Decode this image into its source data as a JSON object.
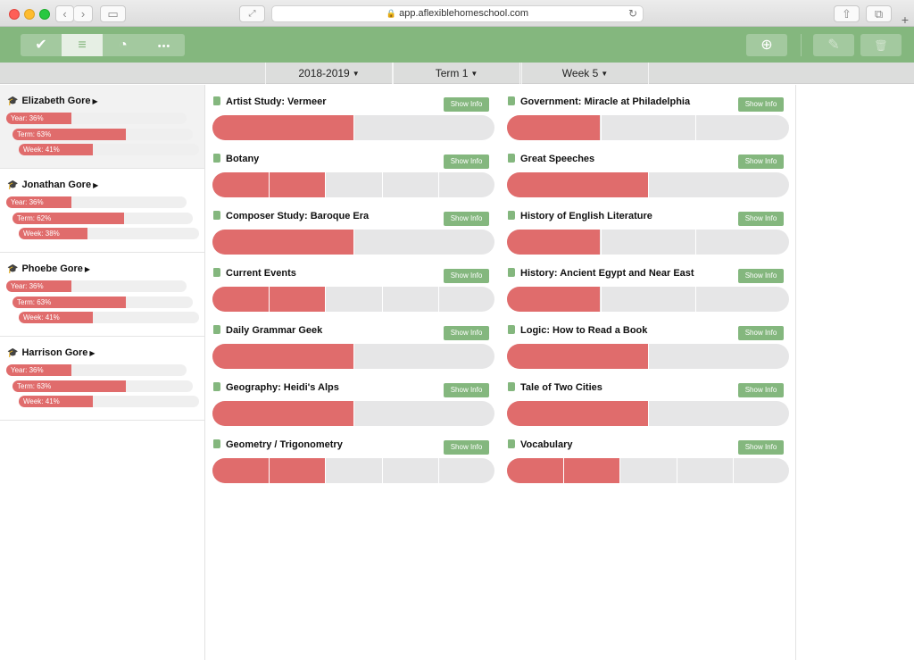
{
  "browser": {
    "url": "app.aflexiblehomeschool.com",
    "back_glyph": "‹",
    "fwd_glyph": "›",
    "sidebar_glyph": "▭",
    "reader_glyph": "⤢",
    "reload_glyph": "↻",
    "lock_glyph": "🔒",
    "share_glyph": "⇧",
    "tabs_glyph": "⧉",
    "newtab_glyph": "+"
  },
  "toolbar": {
    "buttons": [
      {
        "icon": "checkmark-icon",
        "glyph": "✔"
      },
      {
        "icon": "bars-icon",
        "glyph": "≡"
      },
      {
        "icon": "pie-chart-icon",
        "glyph": "◔"
      },
      {
        "icon": "more-icon",
        "glyph": "•••"
      }
    ],
    "add_glyph": "⊕",
    "edit_glyph": "✎",
    "delete_glyph": "🗑"
  },
  "selectors": {
    "year": "2018-2019",
    "term": "Term 1",
    "week": "Week 5",
    "caret": "▼"
  },
  "students": [
    {
      "name": "Elizabeth Gore",
      "year_label": "Year: 36%",
      "year": 0.36,
      "term_label": "Term: 63%",
      "term": 0.63,
      "week_label": "Week: 41%",
      "week": 0.41
    },
    {
      "name": "Jonathan Gore",
      "year_label": "Year: 36%",
      "year": 0.36,
      "term_label": "Term: 62%",
      "term": 0.62,
      "week_label": "Week: 38%",
      "week": 0.38
    },
    {
      "name": "Phoebe Gore",
      "year_label": "Year: 36%",
      "year": 0.36,
      "term_label": "Term: 63%",
      "term": 0.63,
      "week_label": "Week: 41%",
      "week": 0.41
    },
    {
      "name": "Harrison Gore",
      "year_label": "Year: 36%",
      "year": 0.36,
      "term_label": "Term: 63%",
      "term": 0.63,
      "week_label": "Week: 41%",
      "week": 0.41
    }
  ],
  "student_glyphs": {
    "cap": "🎓",
    "arrow": "▶"
  },
  "show_info_label": "Show Info",
  "courses": [
    {
      "title": "Artist Study: Vermeer",
      "progress": 0.5,
      "segments": 2
    },
    {
      "title": "Government: Miracle at Philadelphia",
      "progress": 0.33,
      "segments": 3
    },
    {
      "title": "Botany",
      "progress": 0.4,
      "segments": 5
    },
    {
      "title": "Great Speeches",
      "progress": 0.5,
      "segments": 2
    },
    {
      "title": "Composer Study: Baroque Era",
      "progress": 0.5,
      "segments": 2
    },
    {
      "title": "History of English Literature",
      "progress": 0.33,
      "segments": 3
    },
    {
      "title": "Current Events",
      "progress": 0.4,
      "segments": 5
    },
    {
      "title": "History: Ancient Egypt and Near East",
      "progress": 0.33,
      "segments": 3
    },
    {
      "title": "Daily Grammar Geek",
      "progress": 0.5,
      "segments": 2
    },
    {
      "title": "Logic: How to Read a Book",
      "progress": 0.5,
      "segments": 2
    },
    {
      "title": "Geography: Heidi's Alps",
      "progress": 0.5,
      "segments": 2
    },
    {
      "title": "Tale of Two Cities",
      "progress": 0.5,
      "segments": 2
    },
    {
      "title": "Geometry / Trigonometry",
      "progress": 0.4,
      "segments": 5
    },
    {
      "title": "Vocabulary",
      "progress": 0.4,
      "segments": 5
    }
  ],
  "colors": {
    "accent": "#84b77e",
    "progress": "#e06c6c",
    "track": "#e6e6e7"
  }
}
